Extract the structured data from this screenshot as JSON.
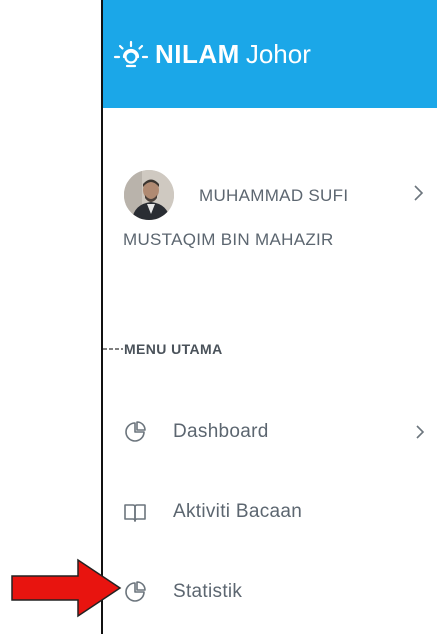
{
  "app": {
    "brand_bold": "NILAM",
    "brand_light": "Johor",
    "brand_icon": "sun-icon",
    "accent_color": "#1ba7e8"
  },
  "profile": {
    "name_line_1": "MUHAMMAD SUFI",
    "name_line_2": "MUSTAQIM BIN MAHAZIR",
    "chevron_icon": "chevron-right-icon"
  },
  "menu": {
    "section_title": "MENU UTAMA",
    "items": [
      {
        "label": "Dashboard",
        "icon": "pie-chart-icon",
        "has_chevron": true
      },
      {
        "label": "Aktiviti Bacaan",
        "icon": "open-book-icon",
        "has_chevron": false
      },
      {
        "label": "Statistik",
        "icon": "pie-chart-icon",
        "has_chevron": false
      }
    ]
  },
  "annotation": {
    "arrow_color": "#e8140f",
    "arrow_icon": "red-arrow-pointer-icon"
  }
}
